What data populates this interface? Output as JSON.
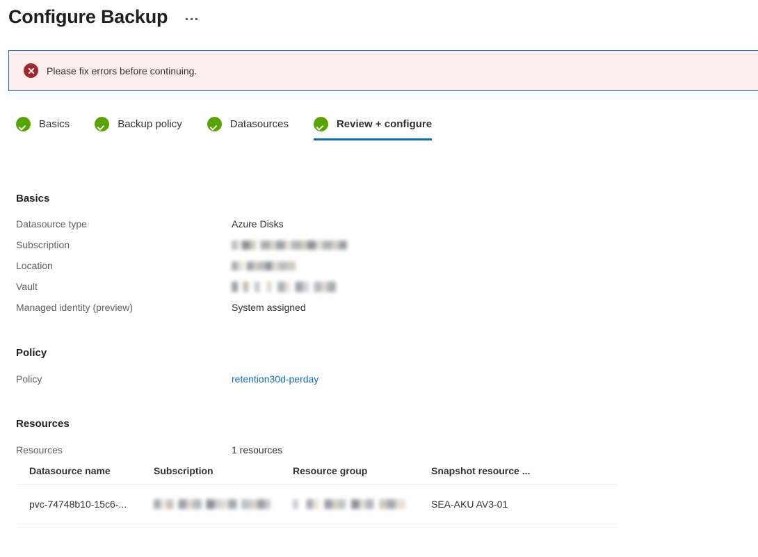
{
  "header": {
    "title": "Configure Backup",
    "more_menu_label": "..."
  },
  "error_banner": {
    "message": "Please fix errors before continuing.",
    "icon": "error-circle-x-icon",
    "background_color": "#fdeeee",
    "border_color": "#0f6cbd",
    "icon_color": "#a4262c"
  },
  "tabs": [
    {
      "label": "Basics",
      "state": "complete",
      "active": false
    },
    {
      "label": "Backup policy",
      "state": "complete",
      "active": false
    },
    {
      "label": "Datasources",
      "state": "complete",
      "active": false
    },
    {
      "label": "Review + configure",
      "state": "complete",
      "active": true
    }
  ],
  "tab_accent_color": "#0f6cbd",
  "check_icon_color": "#57a300",
  "sections": {
    "basics": {
      "title": "Basics",
      "rows": [
        {
          "key": "Datasource type",
          "value": "Azure Disks",
          "redacted": false
        },
        {
          "key": "Subscription",
          "value": "",
          "redacted": true,
          "style": "r-sub"
        },
        {
          "key": "Location",
          "value": "",
          "redacted": true,
          "style": "r-loc"
        },
        {
          "key": "Vault",
          "value": "",
          "redacted": true,
          "style": "r-vault"
        },
        {
          "key": "Managed identity (preview)",
          "value": "System assigned",
          "redacted": false
        }
      ]
    },
    "policy": {
      "title": "Policy",
      "rows": [
        {
          "key": "Policy",
          "value": "retention30d-perday",
          "is_link": true,
          "link_color": "#0f6cbd"
        }
      ]
    },
    "resources": {
      "title": "Resources",
      "rows": [
        {
          "key": "Resources",
          "value": "1 resources"
        }
      ],
      "table": {
        "columns": [
          "Datasource name",
          "Subscription",
          "Resource group",
          "Snapshot resource ..."
        ],
        "rows": [
          {
            "datasource_name": "pvc-74748b10-15c6-...",
            "subscription": "",
            "resource_group": "",
            "snapshot_resource_group": "SEA-AKU AV3-01"
          }
        ]
      }
    }
  }
}
